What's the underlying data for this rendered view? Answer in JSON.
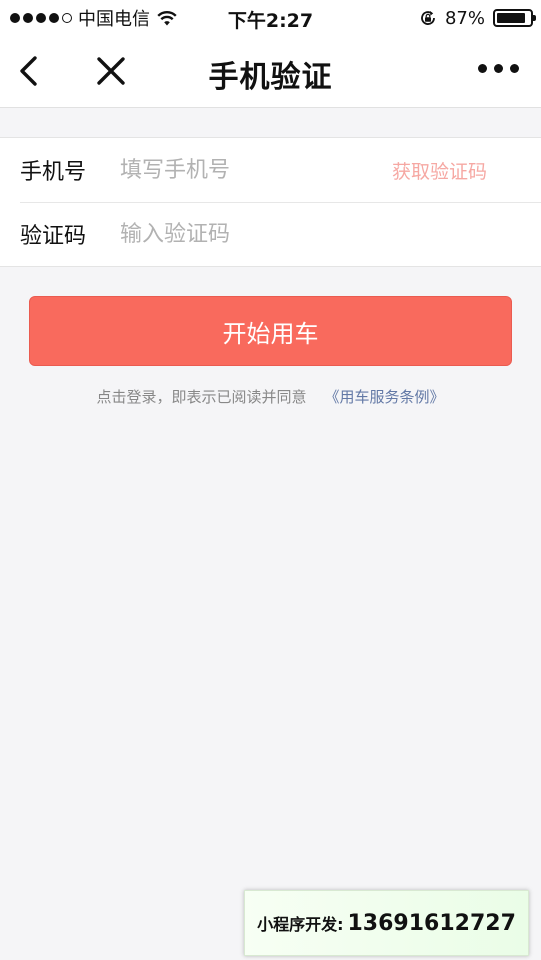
{
  "status_bar": {
    "signal_dots_filled": 4,
    "signal_dots_total": 5,
    "carrier": "中国电信",
    "time": "下午2:27",
    "battery": "87%",
    "battery_level": 0.87,
    "icons": [
      "wifi-icon",
      "rotation-lock-icon",
      "battery-icon"
    ]
  },
  "nav": {
    "title": "手机验证",
    "icons": [
      "back-chevron-icon",
      "close-icon",
      "more-icon"
    ]
  },
  "form": {
    "phone_label": "手机号",
    "phone_placeholder": "填写手机号",
    "phone_value": "",
    "get_code_label": "获取验证码",
    "code_label": "验证码",
    "code_placeholder": "输入验证码",
    "code_value": ""
  },
  "submit_label": "开始用车",
  "agreement": {
    "text": "点击登录，即表示已阅读并同意",
    "link": "《用车服务条例》"
  },
  "badge": {
    "label": "小程序开发:",
    "number": "13691612727"
  },
  "colors": {
    "primary_button": "#f96a5d",
    "get_code_text": "#f6a8a3",
    "link": "#6379a6",
    "page_background": "#f5f5f7"
  }
}
